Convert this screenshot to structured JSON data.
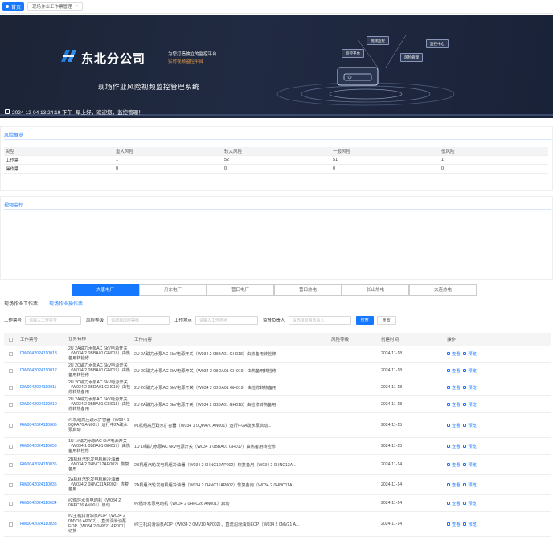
{
  "tabbar": {
    "home_label": "首页",
    "page_label": "现场作业工作票管理",
    "close_icon": "×"
  },
  "banner": {
    "company": "东北分公司",
    "slogan1": "为您打造独立的监控平台",
    "slogan2": "实时视频监控平台",
    "system_title": "现场作业风险视频监控管理系统",
    "datetime": "2024-12-04 13:24:19 下午",
    "welcome": "早上好，欢迎您，监控管理！",
    "float_buttons": [
      "监控平台",
      "视频监控",
      "风险管理",
      "监控中心"
    ],
    "colors": {
      "bg": "#1c2436",
      "accent": "#f0a24a"
    }
  },
  "risk_overview": {
    "title": "风险概览",
    "headers": [
      "类型",
      "重大风险",
      "较大风险",
      "一般风险",
      "低风险"
    ],
    "rows": [
      [
        "工作票",
        "1",
        "52",
        "51",
        "1"
      ],
      [
        "操作票",
        "0",
        "0",
        "0",
        "0"
      ]
    ]
  },
  "video_monitor": {
    "title": "视频监控"
  },
  "units": [
    "大唐电厂",
    "丹东电厂",
    "营口电厂",
    "营口热电",
    "长山热电",
    "大连热电"
  ],
  "subtabs": [
    "现场作业工作票",
    "现场作业操作票"
  ],
  "filters": {
    "code_label": "工作票号",
    "code_placeholder": "请输入工作票号",
    "level_label": "风险等级",
    "level_placeholder": "请选择风险等级",
    "place_label": "工作地点",
    "place_placeholder": "请输入工作地点",
    "person_label": "监督负责人",
    "person_placeholder": "请选择监督负责人",
    "search": "搜索",
    "reset": "重置"
  },
  "table": {
    "headers": [
      "工作票号",
      "任务名称",
      "工作内容",
      "风险等级",
      "创建时间",
      "操作"
    ],
    "view_label": "查看",
    "preview_label": "预览",
    "rows": [
      {
        "code": "DW0042024110013",
        "name": "2U 2A磁力水泵AC 6kV电源开关（W034 2 0BBA01 GH018）由热备用转检修",
        "content": "2U 2A磁力水泵AC 6kV电源开关（W034 2 0BBA01 GH018）由热备用转检修",
        "level": "",
        "date": "2024-11-18"
      },
      {
        "code": "DW0042024110012",
        "name": "2U 2C磁力水泵AC 6kV电源开关（W034 2 0BBA01 GH019）由热备用转检修",
        "content": "2U 2C磁力水泵AC 6kV电源开关（W034 2 0BDA01 GH019）由热备用转检修",
        "level": "",
        "date": "2024-11-18"
      },
      {
        "code": "DW0042024110011",
        "name": "2U 2C磁力水泵AC 6kV电源开关（W034 2 0BDA01 GH019）由检修转热备用",
        "content": "2U 2C磁力水泵AC 6kV电源开关（W034 2 0BDA01 GH019）由检修转热备用",
        "level": "",
        "date": "2024-11-18"
      },
      {
        "code": "DW0042024110010",
        "name": "2U 2A磁力水泵AC 6kV电源开关（W034 2 0BBA01 GH018）由检修转热备用",
        "content": "2U 2A磁力水泵AC 6kV电源开关（W034 2 0BBA01 GH018）由检修转热备用",
        "level": "",
        "date": "2024-11-18"
      },
      {
        "code": "RW0042024110066",
        "name": "#1机组高压疏水扩容器（W034 1 0QPA70 AN001）运行中2A疏水泵启动",
        "content": "#1机组高压疏水扩容器（W034 1 0QPA70 AN001）运行中2A疏水泵启动...",
        "level": "",
        "date": "2024-11-15"
      },
      {
        "code": "RW0042024110058",
        "name": "1U 1#磁力水泵AC 6kV电源开关（W034 1 0BBA01 GH017）由热备用转检修",
        "content": "1U 1#磁力水泵AC 6kV电源开关（W034 1 0BBA01 GH017）由热备用转检修",
        "level": "",
        "date": "2024-11-15"
      },
      {
        "code": "RW0042024110036",
        "name": "2B机组汽轮发电机组冷油器（W034 2 0HNC12AP002）恢复备用",
        "content": "2B机组汽轮发电机组冷油器（W034 2 0HNC12AP002）恢复备用（W034 2 0HNC12A...",
        "level": "",
        "date": "2024-11-14"
      },
      {
        "code": "RW0042024110035",
        "name": "2A机组汽轮发电机组冷油器（W034 2 0HNC11AP002）恢复备用",
        "content": "2A机组汽轮发电机组冷油器（W034 2 0HNC11AP002）恢复备用（W034 2 0HNC11A...",
        "level": "",
        "date": "2024-11-14"
      },
      {
        "code": "RW0042024110034",
        "name": "#2循环水泵电动机（W034 2 0HFC26 AN001）启动",
        "content": "#2循环水泵电动机（W034 2 0HFC26 AN001）启动",
        "level": "",
        "date": "2024-11-14"
      },
      {
        "code": "RW0042024110033",
        "name": "#2主机润滑油泵AOP（W034 2 0MV10 AP002）、直流润滑油泵EOP（W034 2 0MV21 AP001）切换",
        "content": "#2主机润滑油泵AOP（W034 2 0MV10 AP002）、直流润滑油泵EOP（W034 2 0MV21 A...",
        "level": "",
        "date": "2024-11-14"
      }
    ]
  }
}
